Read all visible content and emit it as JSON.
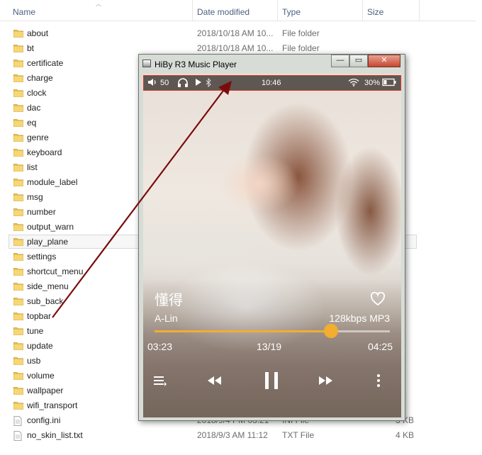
{
  "explorer": {
    "columns": {
      "name": "Name",
      "date": "Date modified",
      "type": "Type",
      "size": "Size"
    },
    "rows": [
      {
        "name": "about",
        "date": "2018/10/18 AM 10...",
        "type": "File folder",
        "size": "",
        "kind": "folder"
      },
      {
        "name": "bt",
        "date": "2018/10/18 AM 10...",
        "type": "File folder",
        "size": "",
        "kind": "folder"
      },
      {
        "name": "certificate",
        "date": "",
        "type": "",
        "size": "",
        "kind": "folder"
      },
      {
        "name": "charge",
        "date": "",
        "type": "",
        "size": "",
        "kind": "folder"
      },
      {
        "name": "clock",
        "date": "",
        "type": "",
        "size": "",
        "kind": "folder"
      },
      {
        "name": "dac",
        "date": "",
        "type": "",
        "size": "",
        "kind": "folder"
      },
      {
        "name": "eq",
        "date": "",
        "type": "",
        "size": "",
        "kind": "folder"
      },
      {
        "name": "genre",
        "date": "",
        "type": "",
        "size": "",
        "kind": "folder"
      },
      {
        "name": "keyboard",
        "date": "",
        "type": "",
        "size": "",
        "kind": "folder"
      },
      {
        "name": "list",
        "date": "",
        "type": "",
        "size": "",
        "kind": "folder"
      },
      {
        "name": "module_label",
        "date": "",
        "type": "",
        "size": "",
        "kind": "folder"
      },
      {
        "name": "msg",
        "date": "",
        "type": "",
        "size": "",
        "kind": "folder"
      },
      {
        "name": "number",
        "date": "",
        "type": "",
        "size": "",
        "kind": "folder"
      },
      {
        "name": "output_warn",
        "date": "",
        "type": "",
        "size": "",
        "kind": "folder"
      },
      {
        "name": "play_plane",
        "date": "",
        "type": "",
        "size": "",
        "kind": "folder",
        "selected": true
      },
      {
        "name": "settings",
        "date": "",
        "type": "",
        "size": "",
        "kind": "folder"
      },
      {
        "name": "shortcut_menu",
        "date": "",
        "type": "",
        "size": "",
        "kind": "folder"
      },
      {
        "name": "side_menu",
        "date": "",
        "type": "",
        "size": "",
        "kind": "folder"
      },
      {
        "name": "sub_back",
        "date": "",
        "type": "",
        "size": "",
        "kind": "folder"
      },
      {
        "name": "topbar",
        "date": "",
        "type": "",
        "size": "",
        "kind": "folder"
      },
      {
        "name": "tune",
        "date": "",
        "type": "",
        "size": "",
        "kind": "folder"
      },
      {
        "name": "update",
        "date": "",
        "type": "",
        "size": "",
        "kind": "folder"
      },
      {
        "name": "usb",
        "date": "",
        "type": "",
        "size": "",
        "kind": "folder"
      },
      {
        "name": "volume",
        "date": "",
        "type": "",
        "size": "",
        "kind": "folder"
      },
      {
        "name": "wallpaper",
        "date": "",
        "type": "",
        "size": "",
        "kind": "folder"
      },
      {
        "name": "wifi_transport",
        "date": "",
        "type": "",
        "size": "",
        "kind": "folder"
      },
      {
        "name": "config.ini",
        "date": "2018/9/4 PM 03:21",
        "type": "INI File",
        "size": "3 KB",
        "kind": "file"
      },
      {
        "name": "no_skin_list.txt",
        "date": "2018/9/3 AM 11:12",
        "type": "TXT File",
        "size": "4 KB",
        "kind": "file"
      }
    ]
  },
  "player": {
    "window_title": "HiBy R3 Music Player",
    "minimize_glyph": "—",
    "maximize_glyph": "▭",
    "close_glyph": "✕",
    "topbar": {
      "volume": "50",
      "time": "10:46",
      "battery": "30%"
    },
    "song_title": "懂得",
    "artist": "A-Lin",
    "quality": "128kbps MP3",
    "progress_fraction": 0.75,
    "elapsed": "03:23",
    "track_index": "13/19",
    "duration": "04:25",
    "icons": {
      "volume": "speaker-icon",
      "headphones": "headphones-icon",
      "play_state": "play-icon",
      "bluetooth": "bluetooth-icon",
      "wifi": "wifi-icon",
      "battery": "battery-icon",
      "favorite": "heart-icon",
      "playlist": "playlist-icon",
      "previous": "rewind-icon",
      "pause": "pause-icon",
      "next": "fast-forward-icon",
      "more": "more-icon"
    },
    "accent_color": "#f3ad2f",
    "highlight_color": "#d8362c"
  },
  "annotation": {
    "arrow_color": "#7a0c0c"
  }
}
